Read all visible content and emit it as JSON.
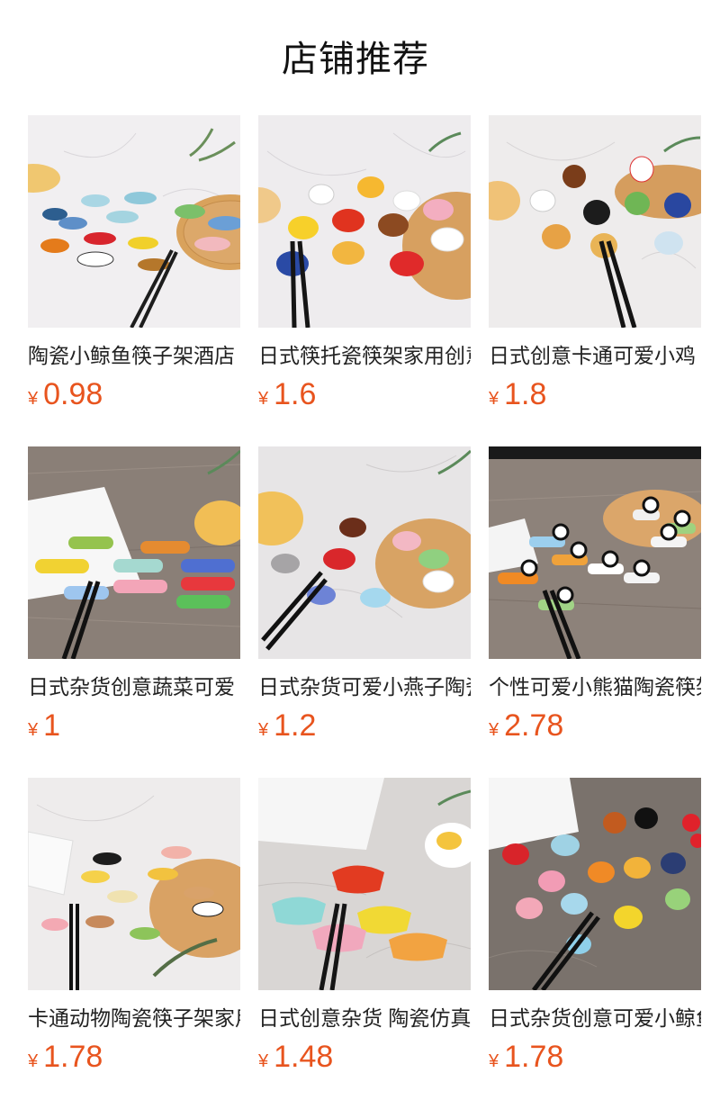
{
  "page": {
    "title": "店铺推荐"
  },
  "currency_symbol": "¥",
  "products": [
    {
      "name": "陶瓷小鲸鱼筷子架酒店",
      "price": "0.98",
      "image_icon": "whale-chopstick-rest-image"
    },
    {
      "name": "日式筷托瓷筷架家用创意",
      "price": "1.6",
      "image_icon": "duck-chopstick-rest-image"
    },
    {
      "name": "日式创意卡通可爱小鸡",
      "price": "1.8",
      "image_icon": "rooster-chopstick-rest-image"
    },
    {
      "name": "日式杂货创意蔬菜可爱",
      "price": "1",
      "image_icon": "peapod-chopstick-rest-image"
    },
    {
      "name": "日式杂货可爱小燕子陶瓷",
      "price": "1.2",
      "image_icon": "bird-chopstick-rest-image"
    },
    {
      "name": "个性可爱小熊猫陶瓷筷架",
      "price": "2.78",
      "image_icon": "panda-chopstick-rest-image"
    },
    {
      "name": "卡通动物陶瓷筷子架家用",
      "price": "1.78",
      "image_icon": "animal-chopstick-rest-image"
    },
    {
      "name": "日式创意杂货 陶瓷仿真",
      "price": "1.48",
      "image_icon": "dumpling-chopstick-rest-image"
    },
    {
      "name": "日式杂货创意可爱小鲸鱼",
      "price": "1.78",
      "image_icon": "fish-chopstick-rest-image"
    }
  ]
}
